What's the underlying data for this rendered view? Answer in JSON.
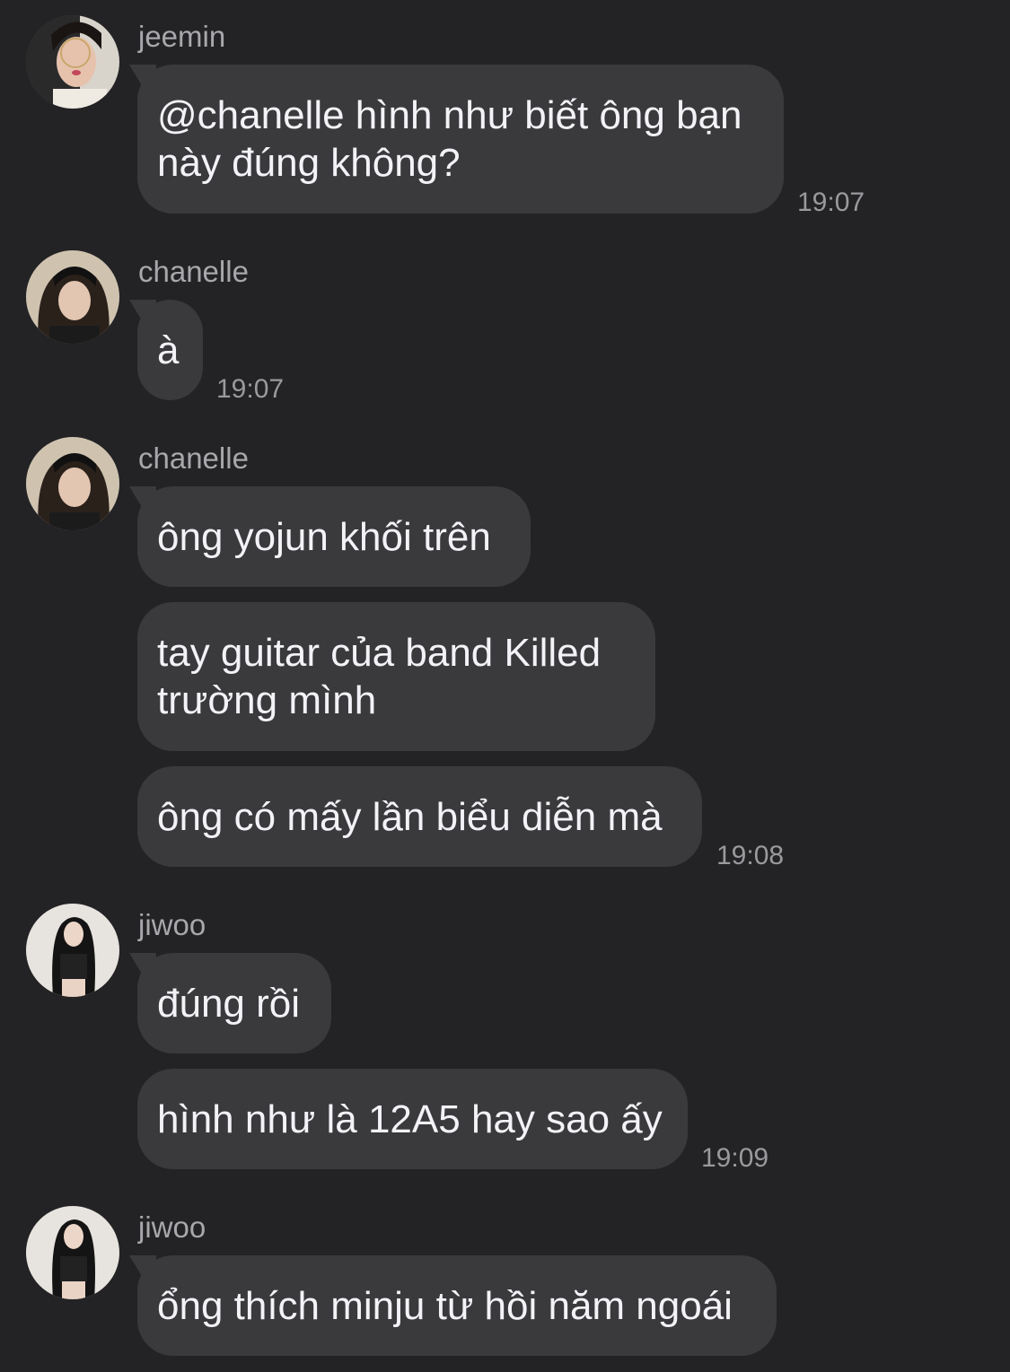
{
  "colors": {
    "background": "#232325",
    "bubble": "#3a3a3c",
    "text": "#f2f2f7",
    "meta": "#a8a8ac"
  },
  "messages": [
    {
      "sender": "jeemin",
      "avatar_icon": "jeemin-avatar-icon",
      "bubbles": [
        "@chanelle hình như biết ông bạn\nnày đúng không?"
      ],
      "time": "19:07"
    },
    {
      "sender": "chanelle",
      "avatar_icon": "chanelle-avatar-icon",
      "bubbles": [
        "à"
      ],
      "time": "19:07"
    },
    {
      "sender": "chanelle",
      "avatar_icon": "chanelle-avatar-icon",
      "bubbles": [
        "ông yojun khối trên",
        "tay guitar của band Killed\ntrường mình",
        "ông có mấy lần biểu diễn mà"
      ],
      "time": "19:08"
    },
    {
      "sender": "jiwoo",
      "avatar_icon": "jiwoo-avatar-icon",
      "bubbles": [
        "đúng rồi",
        "hình như là 12A5 hay sao ấy"
      ],
      "time": "19:09"
    },
    {
      "sender": "jiwoo",
      "avatar_icon": "jiwoo-avatar-icon",
      "bubbles": [
        "ổng thích minju từ hồi năm ngoái"
      ],
      "time": ""
    }
  ]
}
